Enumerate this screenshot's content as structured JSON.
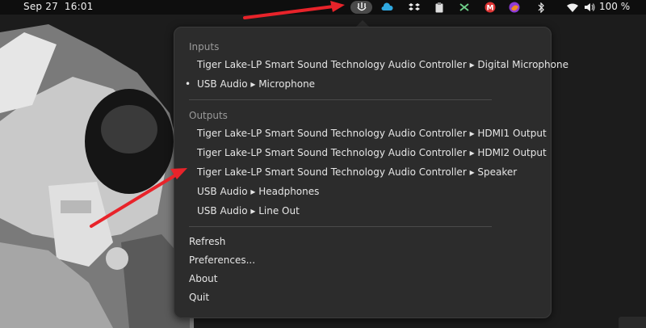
{
  "topbar": {
    "date": "Sep 27",
    "time": "16:01",
    "battery": "100 %"
  },
  "tray_icons": [
    "sound-input-output-chooser-icon",
    "cloud-icon",
    "dropbox-icon",
    "clipboard-icon",
    "network-tool-icon",
    "gmail-icon",
    "firefox-icon",
    "bluetooth-icon",
    "wifi-icon",
    "volume-icon"
  ],
  "menu": {
    "inputs_title": "Inputs",
    "inputs": [
      {
        "label": "Tiger Lake-LP Smart Sound Technology Audio Controller ▸ Digital Microphone",
        "selected": false
      },
      {
        "label": "USB Audio ▸ Microphone",
        "selected": true
      }
    ],
    "outputs_title": "Outputs",
    "outputs": [
      {
        "label": "Tiger Lake-LP Smart Sound Technology Audio Controller ▸ HDMI1 Output",
        "selected": false
      },
      {
        "label": "Tiger Lake-LP Smart Sound Technology Audio Controller ▸ HDMI2 Output",
        "selected": false
      },
      {
        "label": "Tiger Lake-LP Smart Sound Technology Audio Controller ▸ Speaker",
        "selected": false
      },
      {
        "label": "USB Audio ▸ Headphones",
        "selected": false
      },
      {
        "label": "USB Audio ▸ Line Out",
        "selected": false
      }
    ],
    "actions": [
      "Refresh",
      "Preferences...",
      "About",
      "Quit"
    ],
    "selected_bullet": "•"
  },
  "colors": {
    "annotation_arrow": "#e8232a",
    "menu_bg": "#2c2c2c",
    "topbar_bg": "#0e0e0e"
  }
}
